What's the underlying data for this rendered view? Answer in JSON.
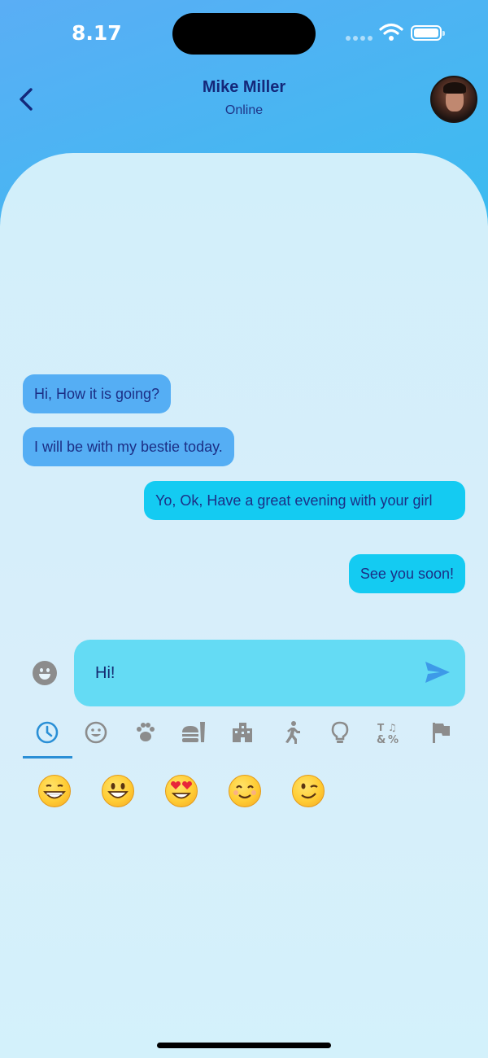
{
  "status_bar": {
    "time": "8.17"
  },
  "header": {
    "contact_name": "Mike Miller",
    "contact_status": "Online"
  },
  "messages": [
    {
      "direction": "incoming",
      "text": "Hi, How it is going?"
    },
    {
      "direction": "incoming",
      "text": "I will be with my bestie today."
    },
    {
      "direction": "outgoing",
      "text": "Yo, Ok, Have a great evening with your girl"
    },
    {
      "direction": "outgoing",
      "text": "See you soon!"
    }
  ],
  "composer": {
    "input_value": "Hi!"
  },
  "emoji_picker": {
    "tabs": [
      {
        "icon": "clock-icon",
        "selected": true
      },
      {
        "icon": "smiley-icon",
        "selected": false
      },
      {
        "icon": "paw-icon",
        "selected": false
      },
      {
        "icon": "food-icon",
        "selected": false
      },
      {
        "icon": "buildings-icon",
        "selected": false
      },
      {
        "icon": "running-person-icon",
        "selected": false
      },
      {
        "icon": "lightbulb-icon",
        "selected": false
      },
      {
        "icon": "symbols-icon",
        "selected": false
      },
      {
        "icon": "flag-icon",
        "selected": false
      }
    ],
    "recent_emojis": [
      "😁",
      "😃",
      "😍",
      "😊",
      "😉"
    ]
  },
  "colors": {
    "incoming_bubble": "#55aef4",
    "outgoing_bubble": "#14cbf2",
    "input_box": "#64dbf4",
    "accent": "#2a8fd6",
    "icon_gray": "#8c8c8c",
    "text_navy": "#1c2f86"
  }
}
